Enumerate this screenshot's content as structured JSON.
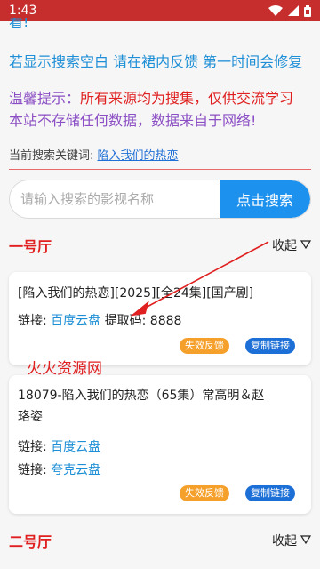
{
  "status_bar": {
    "time": "1:43",
    "icons": [
      "wifi-icon",
      "signal-icon",
      "battery-icon"
    ]
  },
  "partial_top_text": "看!",
  "notice": "若显示搜索空白 请在裙内反馈 第一时间会修复",
  "tip": {
    "label": "温馨提示：",
    "line1_red": "所有来源均为搜集，仅供交流学习",
    "line2": "本站不存储任何数据，数据来自于网络!"
  },
  "keyword": {
    "label": "当前搜索关键词: ",
    "value": "陷入我们的热恋"
  },
  "search": {
    "placeholder": "请输入搜索的影视名称",
    "button_label": "点击搜索"
  },
  "halls": [
    {
      "title": "一号厅",
      "collapse_label": "收起"
    },
    {
      "title": "二号厅",
      "collapse_label": "收起"
    }
  ],
  "cards": [
    {
      "title": "[陷入我们的热恋][2025][全24集][国产剧]",
      "link_label": "链接: ",
      "link_text": "百度云盘",
      "code_text": " 提取码: 8888",
      "feedback_label": "失效反馈",
      "copy_label": "复制链接"
    },
    {
      "title_line1": "18079-陷入我们的热恋（65集）常高明＆赵",
      "title_line2": "珞姿",
      "link1_label": "链接: ",
      "link1_text": "百度云盘",
      "link2_label": "链接: ",
      "link2_text": "夸克云盘",
      "feedback_label": "失效反馈",
      "copy_label": "复制链接"
    }
  ],
  "watermark": "火火资源网",
  "colors": {
    "accent_red": "#e02020",
    "link_blue": "#1e8fd6",
    "button_blue": "#1c91ee",
    "status_bar": "#c62d2d"
  }
}
